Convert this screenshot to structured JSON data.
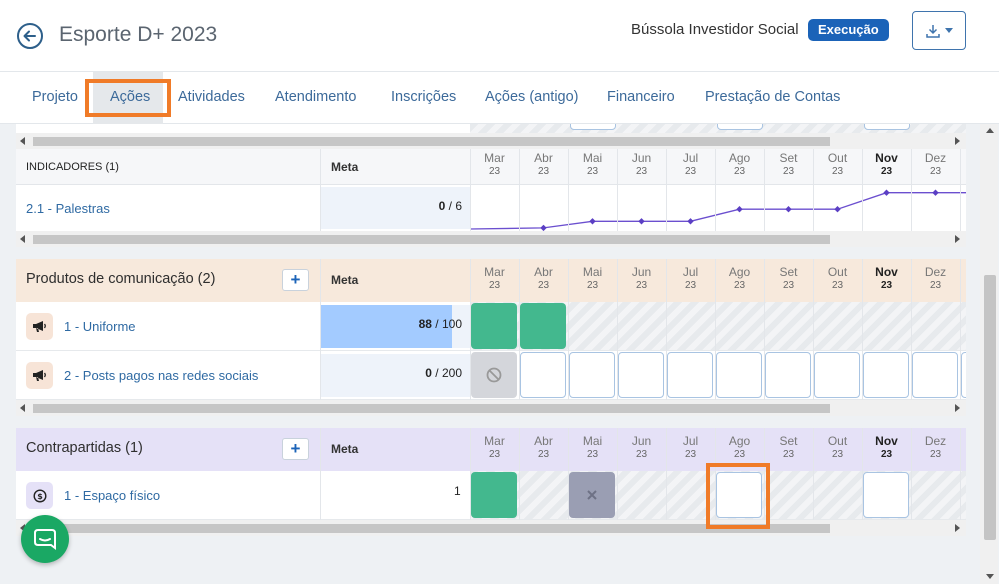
{
  "header": {
    "title": "Esporte D+ 2023",
    "org": "Bússola Investidor Social",
    "status_badge": "Execução",
    "status_color": "#1b63b8"
  },
  "tabs": [
    {
      "label": "Projeto"
    },
    {
      "label": "Ações",
      "active": true
    },
    {
      "label": "Atividades"
    },
    {
      "label": "Atendimento"
    },
    {
      "label": "Inscrições"
    },
    {
      "label": "Ações (antigo)"
    },
    {
      "label": "Financeiro"
    },
    {
      "label": "Prestação de Contas"
    }
  ],
  "months": [
    {
      "m": "Mar",
      "y": "23"
    },
    {
      "m": "Abr",
      "y": "23"
    },
    {
      "m": "Mai",
      "y": "23"
    },
    {
      "m": "Jun",
      "y": "23"
    },
    {
      "m": "Jul",
      "y": "23"
    },
    {
      "m": "Ago",
      "y": "23"
    },
    {
      "m": "Set",
      "y": "23"
    },
    {
      "m": "Out",
      "y": "23"
    },
    {
      "m": "Nov",
      "y": "23",
      "current": true
    },
    {
      "m": "Dez",
      "y": "23"
    }
  ],
  "indicadores": {
    "title": "INDICADORES (1)",
    "meta_header": "Meta",
    "rows": [
      {
        "label": "2.1 - Palestras",
        "progress": "0",
        "total": "6",
        "trend_level": [
          0,
          0.05,
          0.35,
          0.35,
          0.35,
          0.9,
          0.9,
          0.9,
          1.65,
          1.65,
          1.65
        ]
      }
    ]
  },
  "produtos": {
    "title": "Produtos de comunicação (2)",
    "meta_header": "Meta",
    "add_label": "+",
    "rows": [
      {
        "label": "1 - Uniforme",
        "progress": "88",
        "total": "100",
        "fill": 0.88
      },
      {
        "label": "2 - Posts pagos nas redes sociais",
        "progress": "0",
        "total": "200",
        "fill": 0
      }
    ]
  },
  "contrapartidas": {
    "title": "Contrapartidas (1)",
    "meta_header": "Meta",
    "add_label": "+",
    "rows": [
      {
        "label": "1 - Espaço físico",
        "value": "1"
      }
    ]
  },
  "colors": {
    "produtos_bg": "#f7e9dc",
    "contrapartidas_bg": "#e5e1f7",
    "indicadores_bg": "#f6f7f9",
    "done_green": "#43b88e",
    "highlight": "#f07b28",
    "chat": "#1aa864"
  }
}
